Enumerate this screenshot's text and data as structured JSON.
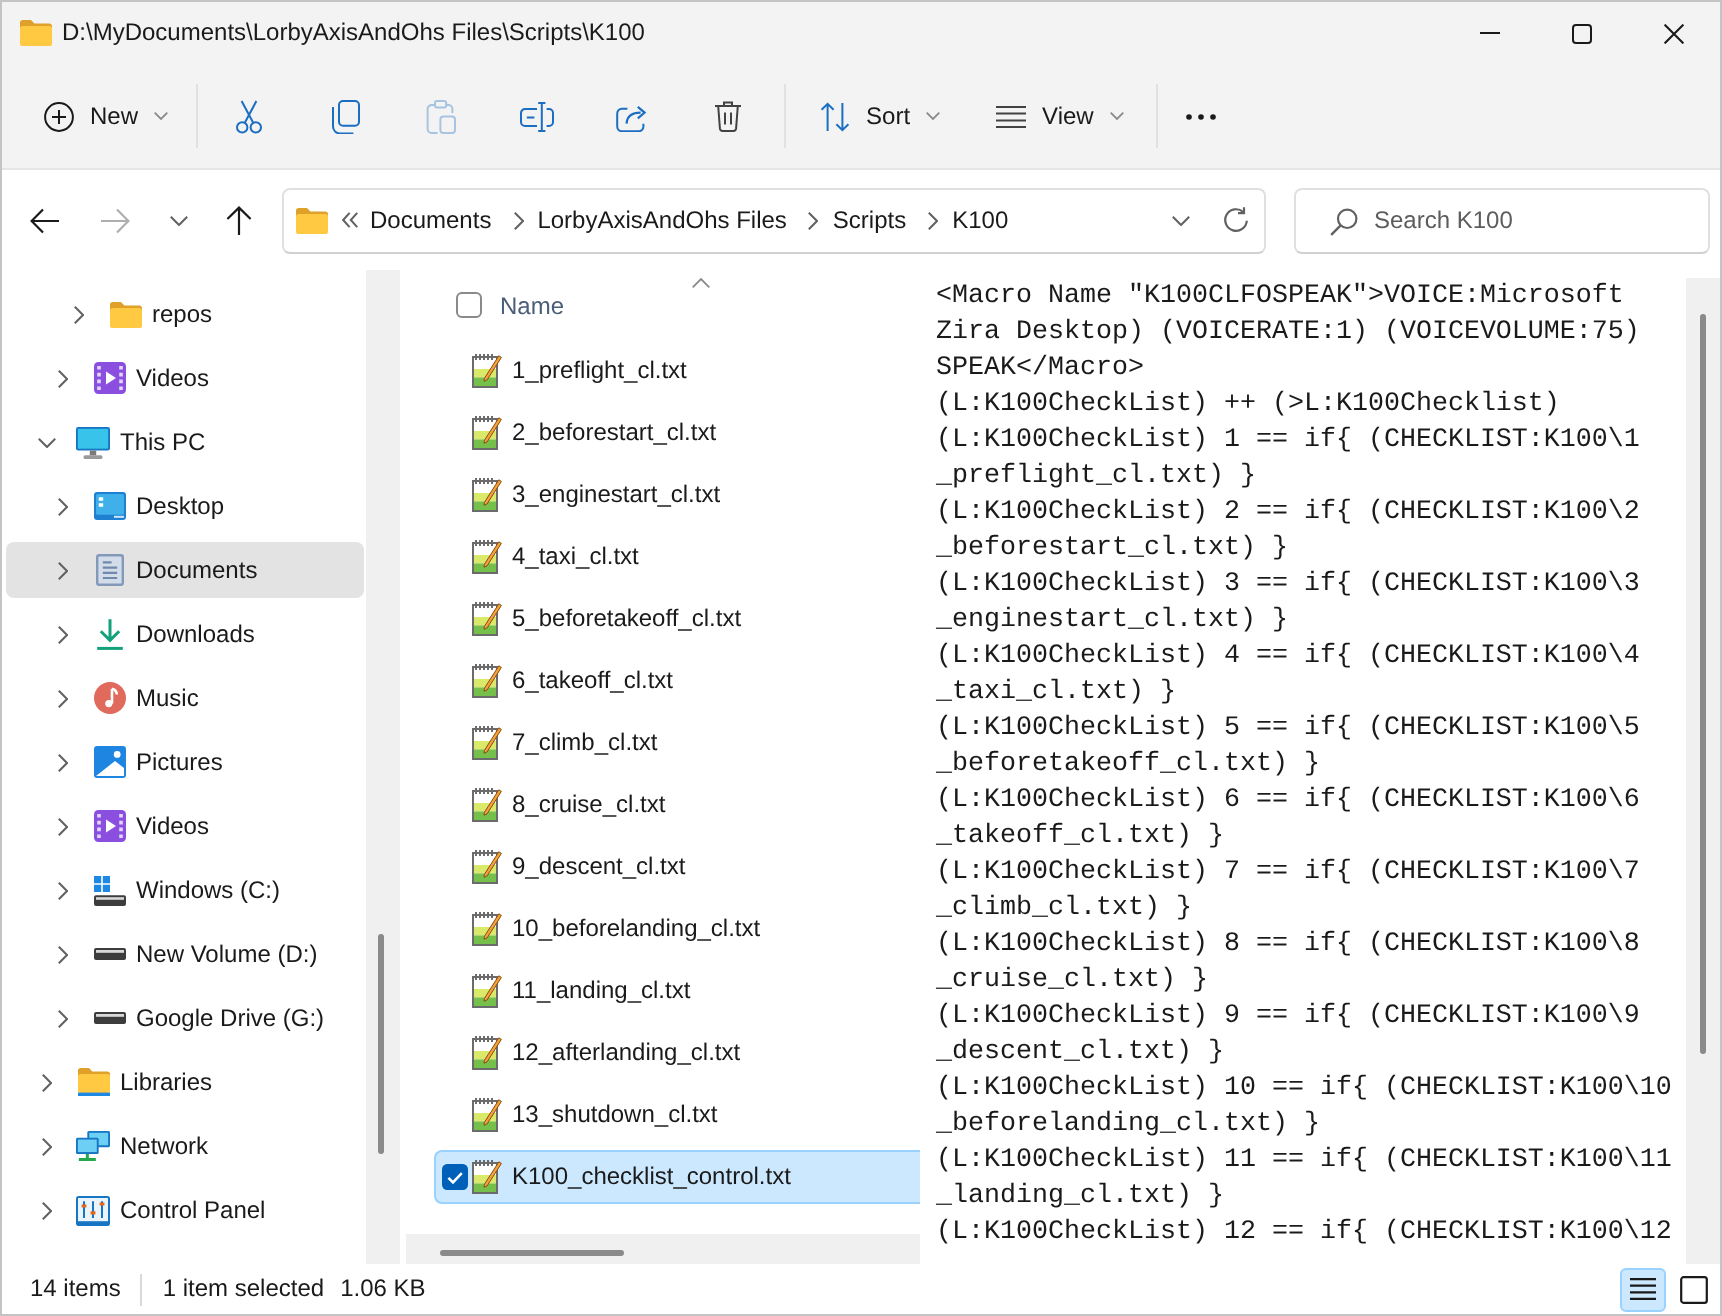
{
  "window": {
    "title": "D:\\MyDocuments\\LorbyAxisAndOhs Files\\Scripts\\K100"
  },
  "toolbar": {
    "items": [
      {
        "kind": "new",
        "label": "New",
        "disabled": false
      },
      {
        "kind": "separator"
      },
      {
        "kind": "cut",
        "disabled": false
      },
      {
        "kind": "copy",
        "disabled": false
      },
      {
        "kind": "paste",
        "disabled": true
      },
      {
        "kind": "rename",
        "disabled": false
      },
      {
        "kind": "share",
        "disabled": false
      },
      {
        "kind": "delete",
        "disabled": false
      },
      {
        "kind": "separator"
      },
      {
        "kind": "sort",
        "label": "Sort",
        "disabled": false
      },
      {
        "kind": "view",
        "label": "View",
        "disabled": false
      },
      {
        "kind": "separator"
      },
      {
        "kind": "more",
        "disabled": false
      }
    ]
  },
  "navigation": {
    "buttons": [
      {
        "kind": "back",
        "disabled": false
      },
      {
        "kind": "forward",
        "disabled": true
      },
      {
        "kind": "recent",
        "disabled": false
      },
      {
        "kind": "up",
        "disabled": false
      }
    ]
  },
  "address_bar": {
    "breadcrumbs": [
      "Documents",
      "LorbyAxisAndOhs Files",
      "Scripts",
      "K100"
    ]
  },
  "search": {
    "placeholder": "Search K100"
  },
  "sidebar": {
    "items": [
      {
        "children": [
          {
            "children": [
              {
                "label": "repos",
                "kind": "folder",
                "expanded": false,
                "selected": false
              }
            ]
          },
          {
            "label": "Videos",
            "kind": "videos",
            "expanded": false,
            "selected": false
          }
        ]
      },
      {
        "label": "This PC",
        "kind": "pc",
        "expanded": true,
        "selected": false,
        "children": [
          {
            "label": "Desktop",
            "kind": "desktop",
            "expanded": false,
            "selected": false
          },
          {
            "label": "Documents",
            "kind": "documents",
            "expanded": false,
            "selected": true
          },
          {
            "label": "Downloads",
            "kind": "downloads",
            "expanded": false,
            "selected": false
          },
          {
            "label": "Music",
            "kind": "music",
            "expanded": false,
            "selected": false
          },
          {
            "label": "Pictures",
            "kind": "pictures",
            "expanded": false,
            "selected": false
          },
          {
            "label": "Videos",
            "kind": "videos",
            "expanded": false,
            "selected": false
          },
          {
            "label": "Windows (C:)",
            "kind": "system-drive",
            "expanded": false,
            "selected": false
          },
          {
            "label": "New Volume (D:)",
            "kind": "drive",
            "expanded": false,
            "selected": false
          },
          {
            "label": "Google Drive (G:)",
            "kind": "drive",
            "expanded": false,
            "selected": false
          }
        ]
      },
      {
        "label": "Libraries",
        "kind": "libraries",
        "expanded": false,
        "selected": false
      },
      {
        "label": "Network",
        "kind": "network",
        "expanded": false,
        "selected": false
      },
      {
        "label": "Control Panel",
        "kind": "control-panel",
        "expanded": false,
        "selected": false
      }
    ]
  },
  "file_list": {
    "select_all": {
      "checked": false
    },
    "columns": [
      {
        "label": "Name",
        "sorted": true
      }
    ],
    "files": [
      {
        "name": "1_preflight_cl.txt",
        "selected": false
      },
      {
        "name": "2_beforestart_cl.txt",
        "selected": false
      },
      {
        "name": "3_enginestart_cl.txt",
        "selected": false
      },
      {
        "name": "4_taxi_cl.txt",
        "selected": false
      },
      {
        "name": "5_beforetakeoff_cl.txt",
        "selected": false
      },
      {
        "name": "6_takeoff_cl.txt",
        "selected": false
      },
      {
        "name": "7_climb_cl.txt",
        "selected": false
      },
      {
        "name": "8_cruise_cl.txt",
        "selected": false
      },
      {
        "name": "9_descent_cl.txt",
        "selected": false
      },
      {
        "name": "10_beforelanding_cl.txt",
        "selected": false
      },
      {
        "name": "11_landing_cl.txt",
        "selected": false
      },
      {
        "name": "12_afterlanding_cl.txt",
        "selected": false
      },
      {
        "name": "13_shutdown_cl.txt",
        "selected": false
      },
      {
        "name": "K100_checklist_control.txt",
        "selected": true
      }
    ]
  },
  "preview": {
    "lines": [
      "<Macro Name \"K100CLFOSPEAK\">VOICE:Microsoft",
      "Zira Desktop) (VOICERATE:1) (VOICEVOLUME:75)",
      "SPEAK</Macro>",
      "(L:K100CheckList) ++ (>L:K100Checklist)",
      "(L:K100CheckList) 1 == if{ (CHECKLIST:K100\\1",
      "_preflight_cl.txt) }",
      "(L:K100CheckList) 2 == if{ (CHECKLIST:K100\\2",
      "_beforestart_cl.txt) }",
      "(L:K100CheckList) 3 == if{ (CHECKLIST:K100\\3",
      "_enginestart_cl.txt) }",
      "(L:K100CheckList) 4 == if{ (CHECKLIST:K100\\4",
      "_taxi_cl.txt) }",
      "(L:K100CheckList) 5 == if{ (CHECKLIST:K100\\5",
      "_beforetakeoff_cl.txt) }",
      "(L:K100CheckList) 6 == if{ (CHECKLIST:K100\\6",
      "_takeoff_cl.txt) }",
      "(L:K100CheckList) 7 == if{ (CHECKLIST:K100\\7",
      "_climb_cl.txt) }",
      "(L:K100CheckList) 8 == if{ (CHECKLIST:K100\\8",
      "_cruise_cl.txt) }",
      "(L:K100CheckList) 9 == if{ (CHECKLIST:K100\\9",
      "_descent_cl.txt) }",
      "(L:K100CheckList) 10 == if{ (CHECKLIST:K100\\10",
      "_beforelanding_cl.txt) }",
      "(L:K100CheckList) 11 == if{ (CHECKLIST:K100\\11",
      "_landing_cl.txt) }",
      "(L:K100CheckList) 12 == if{ (CHECKLIST:K100\\12"
    ]
  },
  "status_bar": {
    "item_count": "14 items",
    "selection": "1 item selected",
    "size": "1.06 KB",
    "views": [
      {
        "kind": "details",
        "selected": true
      },
      {
        "kind": "tiles",
        "selected": false
      }
    ]
  }
}
